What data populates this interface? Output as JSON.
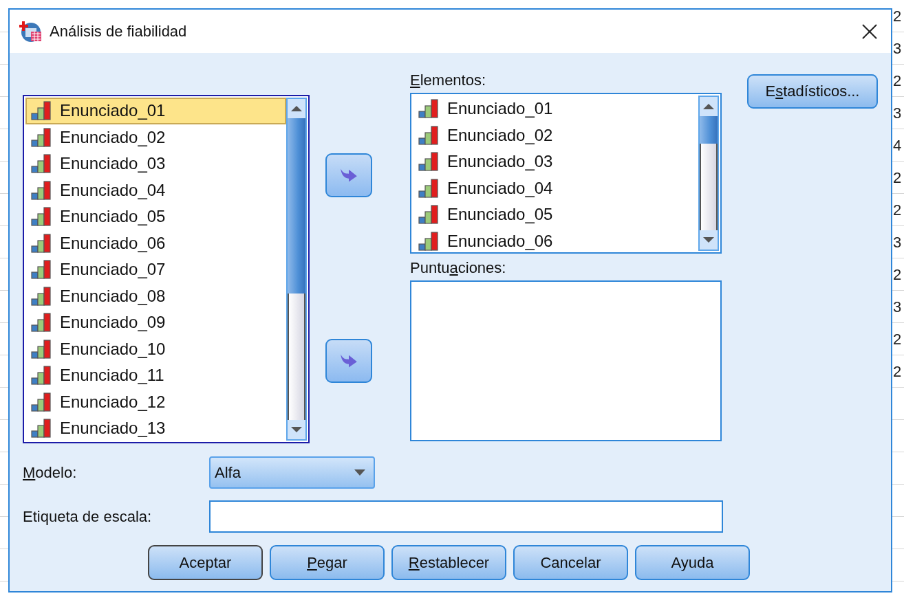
{
  "background_sheet": {
    "cells": [
      "2",
      "3",
      "2",
      "3",
      "4",
      "2",
      "2",
      "3",
      "2",
      "3",
      "2",
      "2"
    ]
  },
  "window": {
    "title": "Análisis de fiabilidad"
  },
  "source_list": {
    "items": [
      {
        "label": "Enunciado_01",
        "selected": true
      },
      {
        "label": "Enunciado_02",
        "selected": false
      },
      {
        "label": "Enunciado_03",
        "selected": false
      },
      {
        "label": "Enunciado_04",
        "selected": false
      },
      {
        "label": "Enunciado_05",
        "selected": false
      },
      {
        "label": "Enunciado_06",
        "selected": false
      },
      {
        "label": "Enunciado_07",
        "selected": false
      },
      {
        "label": "Enunciado_08",
        "selected": false
      },
      {
        "label": "Enunciado_09",
        "selected": false
      },
      {
        "label": "Enunciado_10",
        "selected": false
      },
      {
        "label": "Enunciado_11",
        "selected": false
      },
      {
        "label": "Enunciado_12",
        "selected": false
      },
      {
        "label": "Enunciado_13",
        "selected": false
      }
    ]
  },
  "items_list": {
    "label": {
      "key": "E",
      "rest": "lementos:"
    },
    "items": [
      {
        "label": "Enunciado_01",
        "selected": false
      },
      {
        "label": "Enunciado_02",
        "selected": false
      },
      {
        "label": "Enunciado_03",
        "selected": false
      },
      {
        "label": "Enunciado_04",
        "selected": false
      },
      {
        "label": "Enunciado_05",
        "selected": false
      },
      {
        "label": "Enunciado_06",
        "selected": false
      }
    ]
  },
  "scores_list": {
    "label": {
      "lead": "Puntu",
      "key": "a",
      "rest": "ciones:"
    }
  },
  "statistics_button": {
    "label": {
      "lead": "E",
      "key": "s",
      "rest": "tadísticos..."
    }
  },
  "model": {
    "label": {
      "key": "M",
      "rest": "odelo:"
    },
    "value": "Alfa"
  },
  "scale_label": {
    "label": {
      "rest": "Etiqueta de escala:"
    }
  },
  "buttons": [
    {
      "label": {
        "rest": "Aceptar"
      },
      "default": true
    },
    {
      "label": {
        "key": "P",
        "rest": "egar"
      },
      "default": false
    },
    {
      "label": {
        "key": "R",
        "rest": "establecer"
      },
      "default": false
    },
    {
      "label": {
        "rest": "Cancelar"
      },
      "default": false
    },
    {
      "label": {
        "rest": "Ayuda"
      },
      "default": false
    }
  ]
}
